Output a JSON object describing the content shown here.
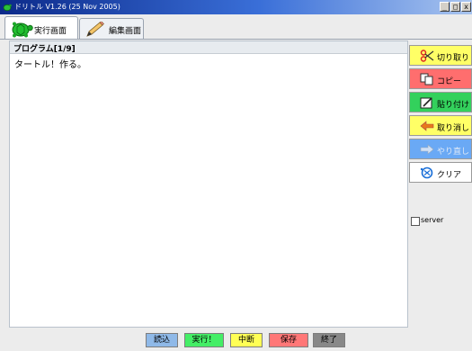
{
  "window": {
    "title": "ドリトル V1.26 (25 Nov 2005)",
    "controls": [
      "_",
      "□",
      "x"
    ]
  },
  "tabs": [
    {
      "label": "実行画面",
      "icon": "turtle-icon",
      "active": true
    },
    {
      "label": "編集画面",
      "icon": "pencil-icon",
      "active": false
    }
  ],
  "editor": {
    "header": "プログラム[1/9]",
    "content": "タートル！作る。"
  },
  "side_buttons": [
    {
      "label": "切り取り",
      "icon": "scissors-icon",
      "color": "#ffff66",
      "enabled": true
    },
    {
      "label": "コピー",
      "icon": "copy-icon",
      "color": "#ff6e6e",
      "enabled": true
    },
    {
      "label": "貼り付け",
      "icon": "paste-icon",
      "color": "#33d15c",
      "enabled": true
    },
    {
      "label": "取り消し",
      "icon": "undo-arrow-icon",
      "color": "#ffff66",
      "enabled": true
    },
    {
      "label": "やり直し",
      "icon": "redo-arrow-icon",
      "color": "#6aa9f5",
      "enabled": false
    },
    {
      "label": "クリア",
      "icon": "clear-icon",
      "color": "#ffffff",
      "enabled": true
    }
  ],
  "server_checkbox": {
    "label": "server",
    "checked": false
  },
  "bottom_buttons": [
    {
      "label": "読込",
      "color": "#8fb9e8"
    },
    {
      "label": "実行！",
      "color": "#44ee66"
    },
    {
      "label": "中断",
      "color": "#ffff55"
    },
    {
      "label": "保存",
      "color": "#ff7777"
    },
    {
      "label": "終了",
      "color": "#888888"
    }
  ]
}
